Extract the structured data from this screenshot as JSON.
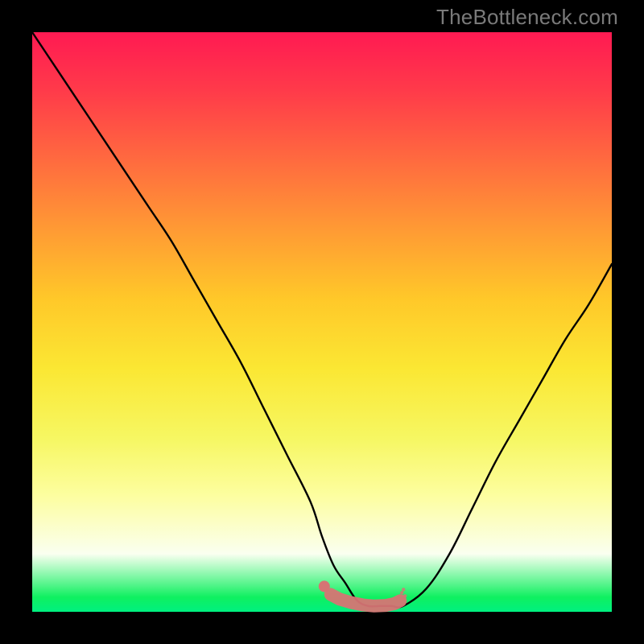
{
  "watermark": "TheBottleneck.com",
  "colors": {
    "background": "#000000",
    "curve_stroke": "#000000",
    "marker_fill": "#d67474",
    "marker_stroke": "#c96464"
  },
  "chart_data": {
    "type": "line",
    "title": "",
    "xlabel": "",
    "ylabel": "",
    "xlim": [
      0,
      100
    ],
    "ylim": [
      0,
      100
    ],
    "grid": false,
    "series": [
      {
        "name": "bottleneck-curve",
        "x": [
          0,
          4,
          8,
          12,
          16,
          20,
          24,
          28,
          32,
          36,
          40,
          44,
          48,
          50,
          52,
          54,
          56,
          58,
          60,
          62,
          64,
          68,
          72,
          76,
          80,
          84,
          88,
          92,
          96,
          100
        ],
        "values": [
          100,
          94,
          88,
          82,
          76,
          70,
          64,
          57,
          50,
          43,
          35,
          27,
          19,
          13,
          8,
          5,
          2,
          1,
          1,
          1,
          1,
          4,
          10,
          18,
          26,
          33,
          40,
          47,
          53,
          60
        ]
      }
    ],
    "markers": {
      "name": "highlight-segment",
      "x": [
        51.5,
        53,
        55,
        57,
        59,
        61,
        62.5,
        63.5
      ],
      "values": [
        3.0,
        2.2,
        1.6,
        1.2,
        1.0,
        1.1,
        1.4,
        1.9
      ]
    }
  }
}
